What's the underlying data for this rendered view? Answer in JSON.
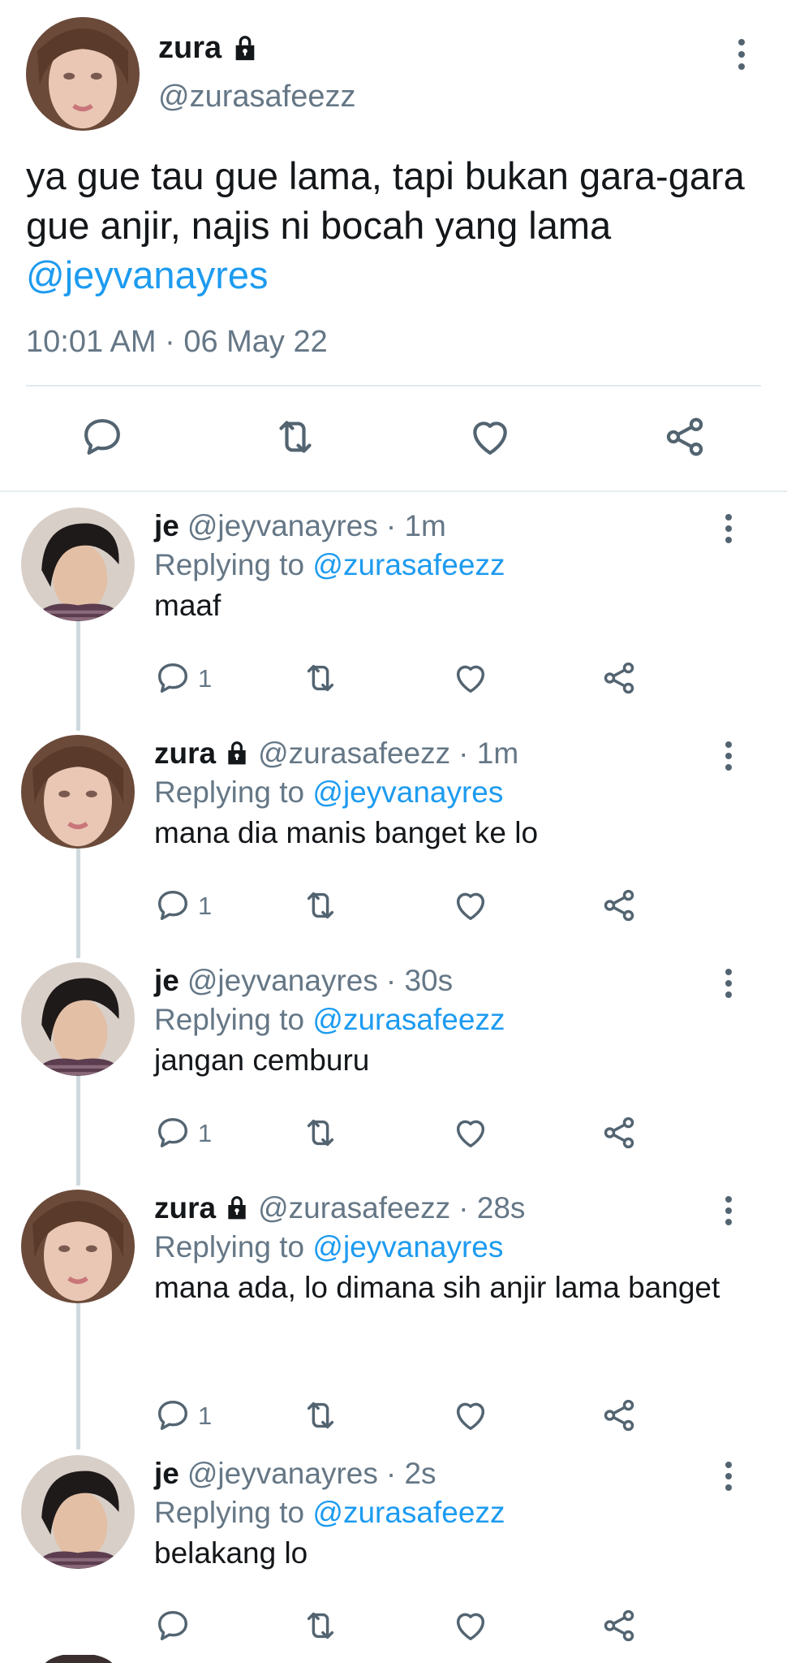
{
  "main_tweet": {
    "name": "zura",
    "handle": "@zurasafeezz",
    "text_part1": "ya gue tau gue lama, tapi bukan gara-gara gue anjir, najis ni bocah yang lama ",
    "text_mention": "@jeyvanayres",
    "timestamp": "10:01 AM · 06 May 22",
    "icons": [
      "reply-icon",
      "retweet-icon",
      "like-icon",
      "share-icon"
    ]
  },
  "replies": [
    {
      "name": "je",
      "handle": "@jeyvanayres",
      "time": "· 1m",
      "locked": false,
      "replying_prefix": "Replying to ",
      "replying_to": "@zurasafeezz",
      "text": "maaf",
      "reply_count": "1"
    },
    {
      "name": "zura",
      "handle": "@zurasafeezz",
      "time": "· 1m",
      "locked": true,
      "replying_prefix": "Replying to ",
      "replying_to": "@jeyvanayres",
      "text": "mana dia manis banget ke lo",
      "reply_count": "1"
    },
    {
      "name": "je",
      "handle": "@jeyvanayres",
      "time": "· 30s",
      "locked": false,
      "replying_prefix": "Replying to ",
      "replying_to": "@zurasafeezz",
      "text": "jangan cemburu",
      "reply_count": "1"
    },
    {
      "name": "zura",
      "handle": "@zurasafeezz",
      "time": "· 28s",
      "locked": true,
      "replying_prefix": "Replying to ",
      "replying_to": "@jeyvanayres",
      "text": "mana ada, lo dimana sih anjir lama banget",
      "reply_count": "1"
    },
    {
      "name": "je",
      "handle": "@jeyvanayres",
      "time": "· 2s",
      "locked": false,
      "replying_prefix": "Replying to ",
      "replying_to": "@zurasafeezz",
      "text": "belakang lo",
      "reply_count": ""
    }
  ],
  "colors": {
    "mention": "#1d9bf0",
    "secondary_text": "#657786",
    "icon": "#536471",
    "thread_line": "#cfd9de"
  }
}
